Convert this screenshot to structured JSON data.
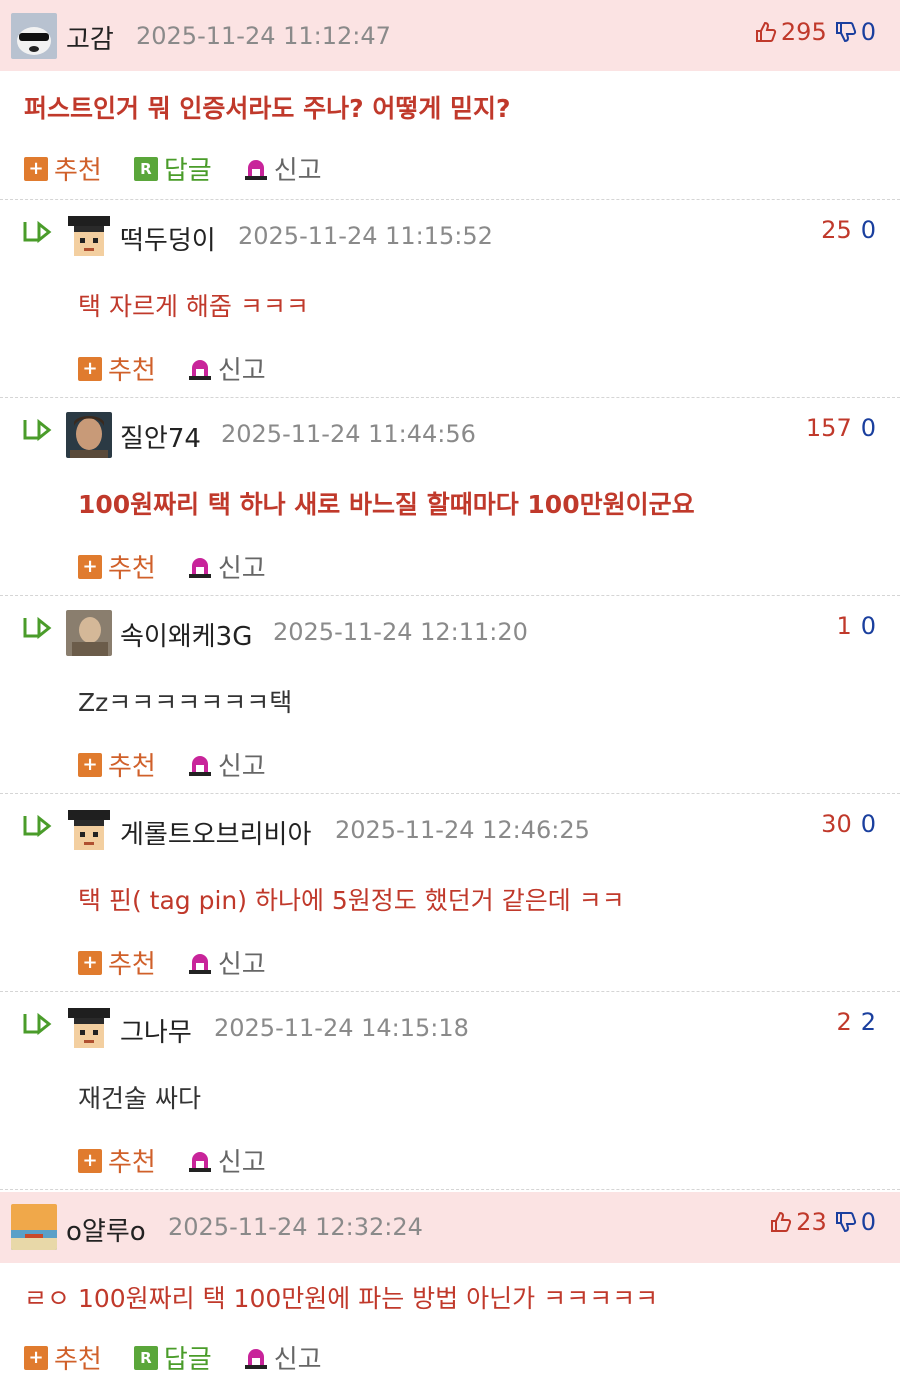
{
  "labels": {
    "recommend": "추천",
    "reply": "답글",
    "report": "신고"
  },
  "colors": {
    "best_bg": "#fbe3e3",
    "accent_red": "#c0392b",
    "accent_blue": "#1a3f9e",
    "recommend_orange": "#e07b2e",
    "reply_green": "#5aa63a"
  },
  "comments": [
    {
      "nick": "고감",
      "date": "2025-11-24 11:12:47",
      "up": "295",
      "down": "0",
      "body": "퍼스트인거 뭐 인증서라도 주나? 어떻게 믿지?",
      "best": true,
      "avatar": "dog-mask-avatar"
    },
    {
      "nick": "떡두덩이",
      "date": "2025-11-24 11:15:52",
      "up": "25",
      "down": "0",
      "body": "택 자르게 해줌 ㅋㅋㅋ",
      "avatar": "pixel-man-avatar"
    },
    {
      "nick": "질안74",
      "date": "2025-11-24 11:44:56",
      "up": "157",
      "down": "0",
      "body": "100원짜리 택 하나 새로 바느질 할때마다 100만원이군요",
      "avatar": "photo-man-avatar"
    },
    {
      "nick": "속이왜케3G",
      "date": "2025-11-24 12:11:20",
      "up": "1",
      "down": "0",
      "body": "Zzㅋㅋㅋㅋㅋㅋㅋ택",
      "avatar": "photo-person-avatar"
    },
    {
      "nick": "게롤트오브리비아",
      "date": "2025-11-24 12:46:25",
      "up": "30",
      "down": "0",
      "body": "택 핀( tag pin) 하나에 5원정도 했던거 같은데 ㅋㅋ",
      "avatar": "pixel-man-avatar"
    },
    {
      "nick": "그나무",
      "date": "2025-11-24 14:15:18",
      "up": "2",
      "down": "2",
      "body": "재건술 싸다",
      "avatar": "pixel-man-avatar"
    },
    {
      "nick": "o얄루o",
      "date": "2025-11-24 12:32:24",
      "up": "23",
      "down": "0",
      "body": "ㄹㅇ 100원짜리 택 100만원에 파는 방법 아닌가 ㅋㅋㅋㅋㅋ",
      "best": true,
      "avatar": "sunset-avatar"
    }
  ]
}
